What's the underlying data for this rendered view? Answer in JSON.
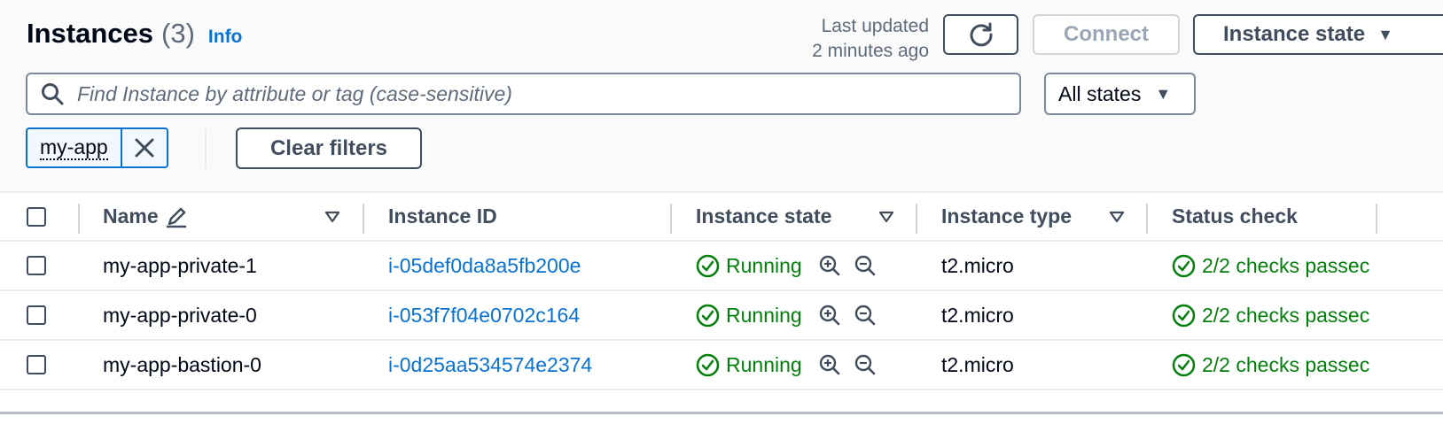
{
  "header": {
    "title": "Instances",
    "count": "(3)",
    "info_label": "Info",
    "last_updated_line1": "Last updated",
    "last_updated_line2": "2 minutes ago",
    "connect_label": "Connect",
    "instance_state_label": "Instance state"
  },
  "filter": {
    "search_placeholder": "Find Instance by attribute or tag (case-sensitive)",
    "states_selected": "All states",
    "token_label": "my-app",
    "clear_label": "Clear filters"
  },
  "table": {
    "columns": [
      "Name",
      "Instance ID",
      "Instance state",
      "Instance type",
      "Status check"
    ],
    "rows": [
      {
        "name": "my-app-private-1",
        "instance_id": "i-05def0da8a5fb200e",
        "state": "Running",
        "type": "t2.micro",
        "status": "2/2 checks passec"
      },
      {
        "name": "my-app-private-0",
        "instance_id": "i-053f7f04e0702c164",
        "state": "Running",
        "type": "t2.micro",
        "status": "2/2 checks passec"
      },
      {
        "name": "my-app-bastion-0",
        "instance_id": "i-0d25aa534574e2374",
        "state": "Running",
        "type": "t2.micro",
        "status": "2/2 checks passec"
      }
    ]
  },
  "colors": {
    "link": "#0972d3",
    "success": "#037f0c",
    "text": "#000716",
    "secondary": "#5f6b7a"
  },
  "icons": [
    "refresh-icon",
    "caret-down-icon",
    "search-icon",
    "close-icon",
    "edit-icon",
    "sort-icon",
    "check-circle-icon",
    "zoom-in-icon",
    "zoom-out-icon"
  ]
}
